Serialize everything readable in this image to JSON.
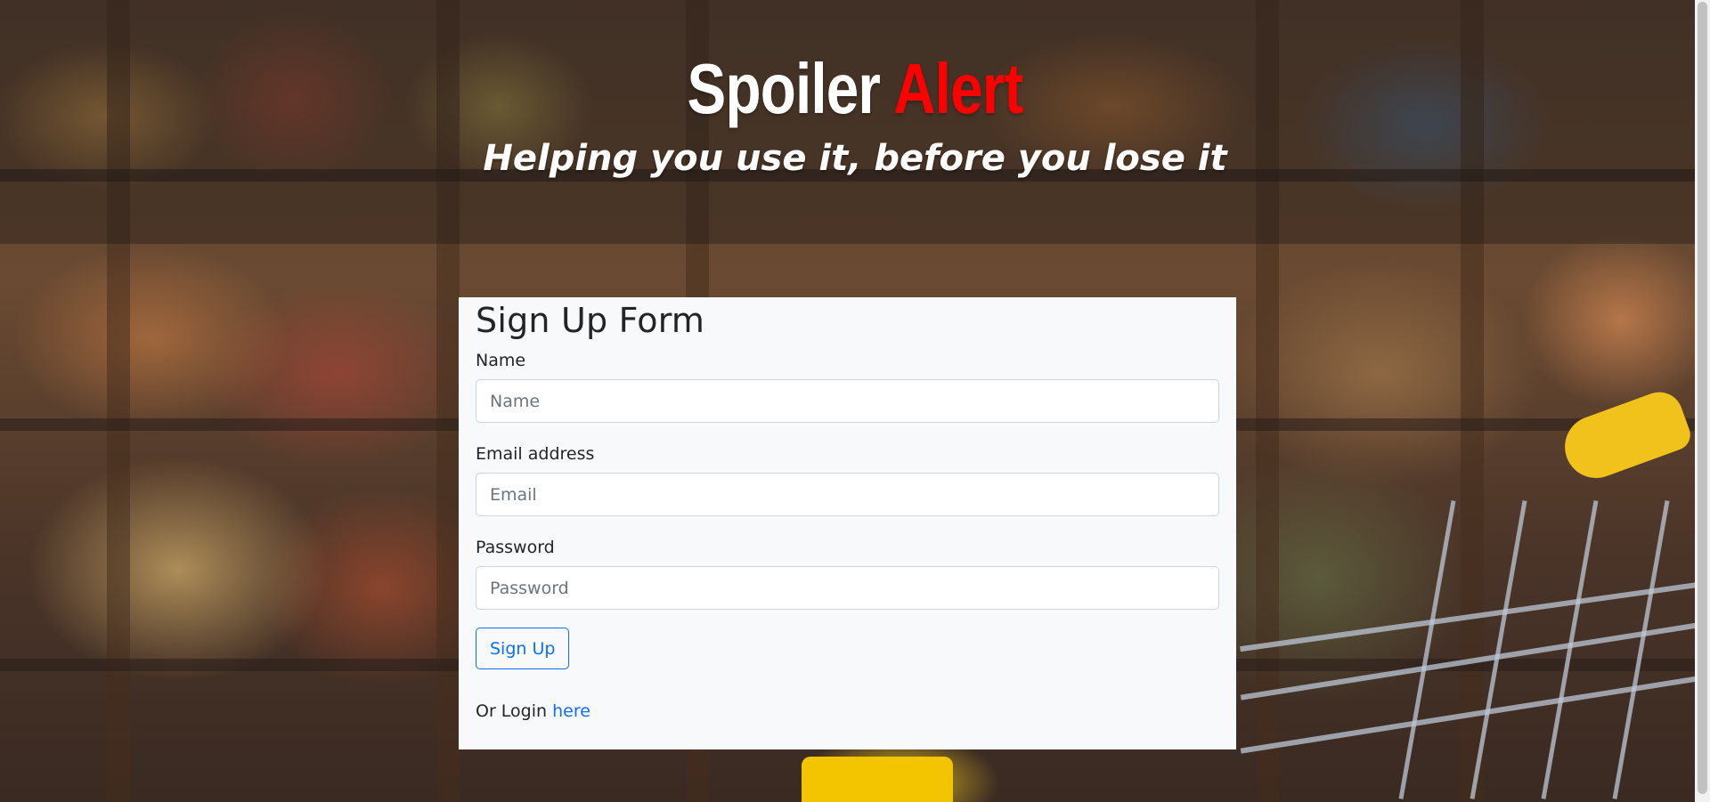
{
  "header": {
    "brand_main": "Spoiler",
    "brand_accent": "Alert",
    "tagline": "Helping you use it, before you lose it"
  },
  "form": {
    "title": "Sign Up Form",
    "fields": [
      {
        "label": "Name",
        "placeholder": "Name",
        "value": ""
      },
      {
        "label": "Email address",
        "placeholder": "Email",
        "value": ""
      },
      {
        "label": "Password",
        "placeholder": "Password",
        "value": ""
      }
    ],
    "submit_label": "Sign Up",
    "login_prefix": "Or Login",
    "login_link": "here"
  },
  "colors": {
    "brand_accent": "#ff0000",
    "link": "#0d6efd",
    "card_bg": "#f8f9fa"
  },
  "icons": {
    "background": "grocery-store-photo"
  }
}
